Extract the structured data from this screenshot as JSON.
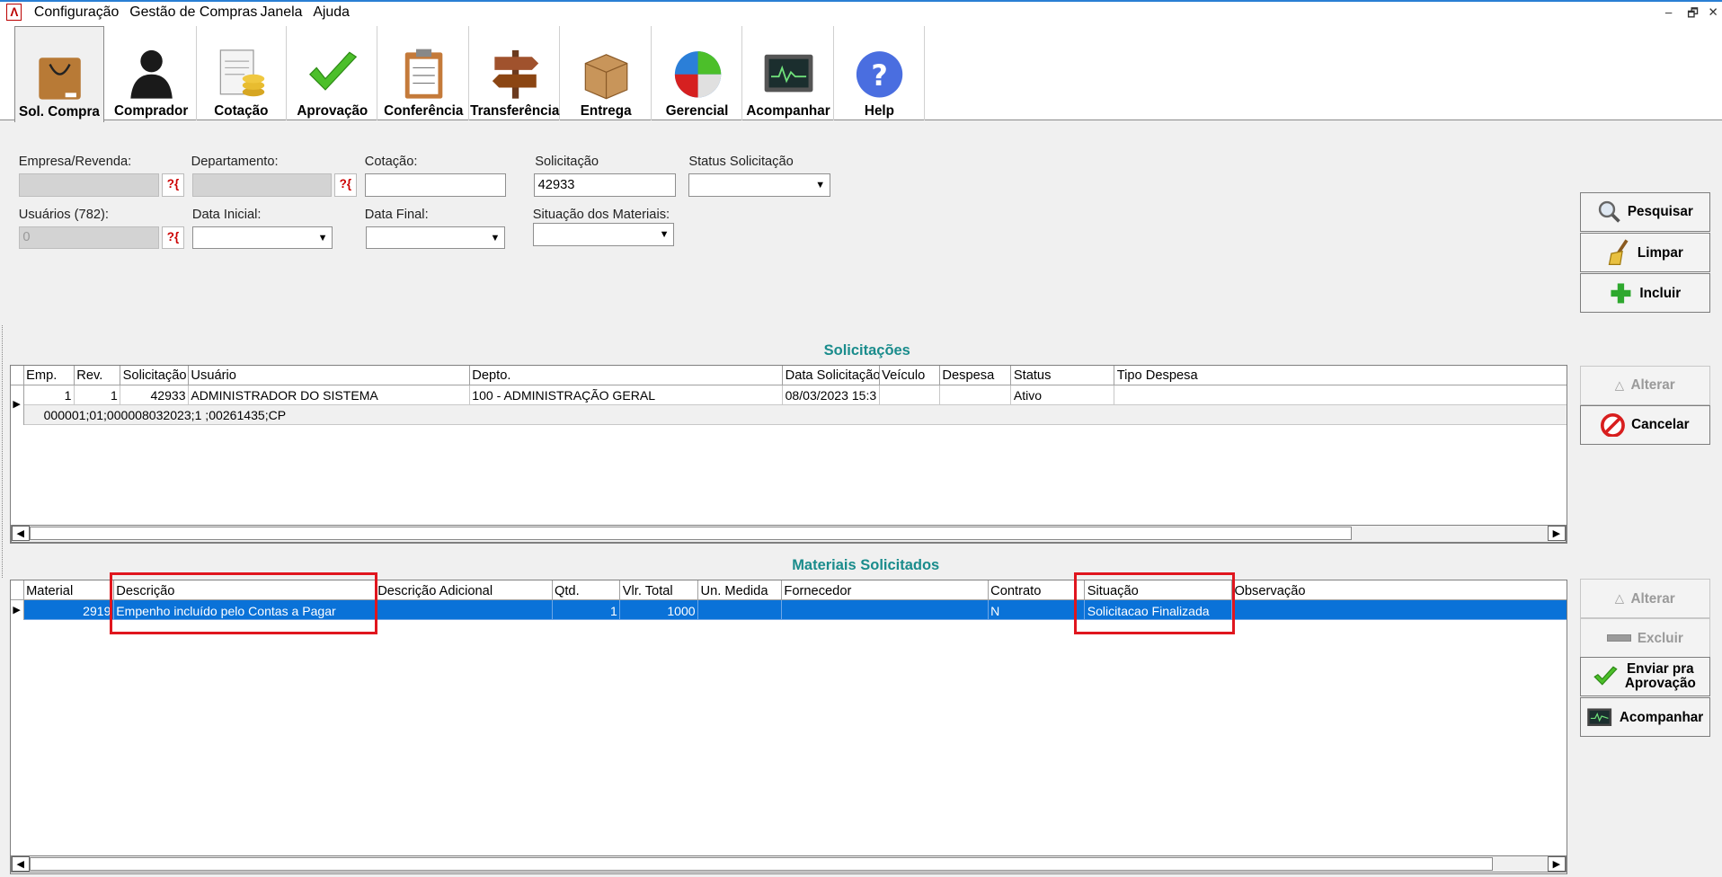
{
  "menu": [
    "Configuração",
    "Gestão de Compras",
    "Janela",
    "Ajuda"
  ],
  "window_controls": [
    "–",
    "🗗",
    "✕"
  ],
  "toolbar": [
    {
      "label": "Sol. Compra",
      "icon": "shopping-bag-icon",
      "selected": true
    },
    {
      "label": "Comprador",
      "icon": "person-icon"
    },
    {
      "label": "Cotação",
      "icon": "quote-coins-icon"
    },
    {
      "label": "Aprovação",
      "icon": "checkmark-icon"
    },
    {
      "label": "Conferência",
      "icon": "clipboard-icon"
    },
    {
      "label": "Transferência",
      "icon": "signpost-icon"
    },
    {
      "label": "Entrega",
      "icon": "box-icon"
    },
    {
      "label": "Gerencial",
      "icon": "pie-chart-icon"
    },
    {
      "label": "Acompanhar",
      "icon": "monitor-icon"
    },
    {
      "label": "Help",
      "icon": "help-icon"
    }
  ],
  "filters": {
    "empresa_label": "Empresa/Revenda:",
    "departamento_label": "Departamento:",
    "cotacao_label": "Cotação:",
    "solicitacao_label": "Solicitação",
    "solicitacao_value": "42933",
    "status_label": "Status Solicitação",
    "usuarios_label": "Usuários (782):",
    "usuarios_value": "0",
    "data_inicial_label": "Data Inicial:",
    "data_final_label": "Data Final:",
    "situacao_label": "Situação dos Materiais:",
    "lookup_glyph": "?{"
  },
  "side_buttons_top": {
    "pesquisar": "Pesquisar",
    "limpar": "Limpar",
    "incluir": "Incluir"
  },
  "side_buttons_mid": {
    "alterar": "Alterar",
    "cancelar": "Cancelar"
  },
  "side_buttons_bottom": {
    "alterar": "Alterar",
    "excluir": "Excluir",
    "enviar": "Enviar pra Aprovação",
    "acompanhar": "Acompanhar"
  },
  "solicitacoes": {
    "title": "Solicitações",
    "columns": [
      "Emp.",
      "Rev.",
      "Solicitação",
      "Usuário",
      "Depto.",
      "Data Solicitação",
      "Veículo",
      "Despesa",
      "Status",
      "Tipo Despesa"
    ],
    "row": {
      "emp": "1",
      "rev": "1",
      "solicitacao": "42933",
      "usuario": "ADMINISTRADOR DO SISTEMA",
      "depto": "100 - ADMINISTRAÇÃO GERAL",
      "data": "08/03/2023 15:3",
      "veiculo": "",
      "despesa": "",
      "status": "Ativo",
      "tipo": ""
    },
    "detail": "000001;01;000008032023;1 ;00261435;CP"
  },
  "materiais": {
    "title": "Materiais Solicitados",
    "columns": [
      "Material",
      "Descrição",
      "Descrição Adicional",
      "Qtd.",
      "Vlr. Total",
      "Un. Medida",
      "Fornecedor",
      "Contrato",
      "Situação",
      "Observação"
    ],
    "row": {
      "material": "2919",
      "descricao": "Empenho incluído pelo Contas a Pagar",
      "adicional": "",
      "qtd": "1",
      "total": "1000",
      "un": "",
      "fornecedor": "",
      "contrato": "N",
      "situacao": "Solicitacao Finalizada",
      "obs": ""
    }
  },
  "colors": {
    "accent": "#1a8c8c",
    "selected_row": "#0a72d8",
    "highlight_box": "#e0161e"
  }
}
